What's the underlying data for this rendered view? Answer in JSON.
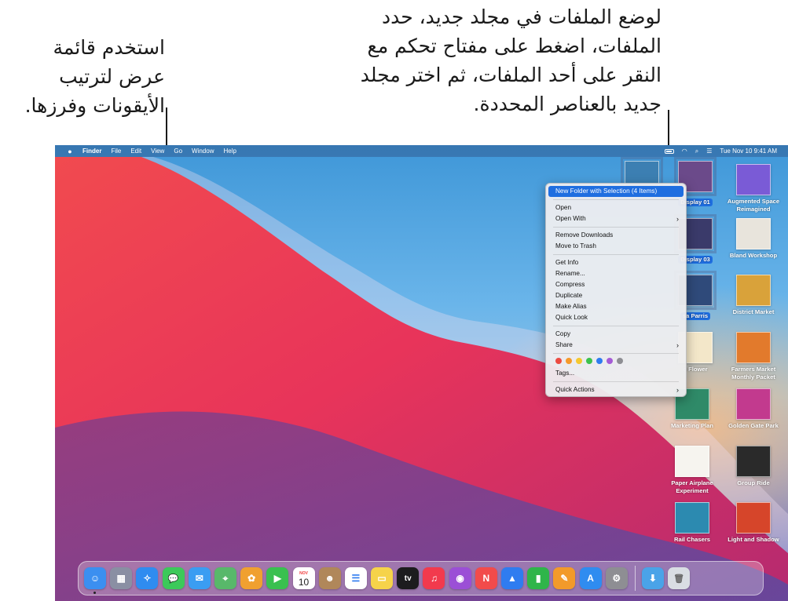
{
  "callouts": {
    "left": [
      "استخدم قائمة",
      "عرض لترتيب",
      "الأيقونات وفرزها."
    ],
    "right": [
      "لوضع الملفات في مجلد جديد، حدد",
      "الملفات، اضغط على مفتاح تحكم مع",
      "النقر على أحد الملفات، ثم اختر مجلد",
      "جديد بالعناصر المحددة."
    ]
  },
  "menubar": {
    "apple": "",
    "app_name": "Finder",
    "menus": [
      "File",
      "Edit",
      "View",
      "Go",
      "Window",
      "Help"
    ],
    "clock": "Tue Nov 10  9:41 AM"
  },
  "desktop_icons": [
    {
      "label": "Display 01",
      "selected": true,
      "color": "#6b4a8a"
    },
    {
      "label": "Augmented Space Reimagined",
      "selected": false,
      "color": "#7a5bd6"
    },
    {
      "label": "Display 03",
      "selected": true,
      "color": "#3a3a6a"
    },
    {
      "label": "Bland Workshop",
      "selected": false,
      "color": "#e8e4dc"
    },
    {
      "label": "sa Parris",
      "selected": true,
      "color": "#2f4a7a"
    },
    {
      "label": "District Market",
      "selected": false,
      "color": "#d9a23a"
    },
    {
      "label": "o Flower",
      "selected": false,
      "color": "#f3e7c9"
    },
    {
      "label": "Farmers Market Monthly Packet",
      "selected": false,
      "color": "#e27a2c"
    },
    {
      "label": "Marketing Plan",
      "selected": false,
      "color": "#2f8a68"
    },
    {
      "label": "Golden Gate Park",
      "selected": false,
      "color": "#c23a8e"
    },
    {
      "label": "Paper Airplane Experiment",
      "selected": false,
      "color": "#f6f4ef"
    },
    {
      "label": "Group Ride",
      "selected": false,
      "color": "#2a2a2a"
    },
    {
      "label": "Rail Chasers",
      "selected": false,
      "color": "#2c8ab0"
    },
    {
      "label": "Light and Shadow",
      "selected": false,
      "color": "#d6452a"
    },
    {
      "label": "",
      "selected": true,
      "color": "#3c7fb2"
    }
  ],
  "context_menu": {
    "groups": [
      [
        {
          "label": "New Folder with Selection (4 Items)",
          "highlighted": true,
          "submenu": false
        }
      ],
      [
        {
          "label": "Open",
          "submenu": false
        },
        {
          "label": "Open With",
          "submenu": true
        }
      ],
      [
        {
          "label": "Remove Downloads",
          "submenu": false
        },
        {
          "label": "Move to Trash",
          "submenu": false
        }
      ],
      [
        {
          "label": "Get Info",
          "submenu": false
        },
        {
          "label": "Rename...",
          "submenu": false
        },
        {
          "label": "Compress",
          "submenu": false
        },
        {
          "label": "Duplicate",
          "submenu": false
        },
        {
          "label": "Make Alias",
          "submenu": false
        },
        {
          "label": "Quick Look",
          "submenu": false
        }
      ],
      [
        {
          "label": "Copy",
          "submenu": false
        },
        {
          "label": "Share",
          "submenu": true
        }
      ]
    ],
    "tag_colors": [
      "#ec4b42",
      "#f59a2a",
      "#f5c82f",
      "#3cc24d",
      "#2f7cf0",
      "#a55bd6",
      "#8e8e93"
    ],
    "tags_label": "Tags...",
    "quick_actions_label": "Quick Actions",
    "chevron": "›"
  },
  "dock": {
    "apps": [
      {
        "name": "Finder",
        "glyph": "☺",
        "color": "#3b8ff0",
        "running": true
      },
      {
        "name": "Launchpad",
        "glyph": "▦",
        "color": "#8a8fa3",
        "running": false
      },
      {
        "name": "Safari",
        "glyph": "✧",
        "color": "#2f8cf0",
        "running": false
      },
      {
        "name": "Messages",
        "glyph": "💬",
        "color": "#3cc95a",
        "running": false
      },
      {
        "name": "Mail",
        "glyph": "✉",
        "color": "#3a9df2",
        "running": false
      },
      {
        "name": "Maps",
        "glyph": "⌖",
        "color": "#58b86a",
        "running": false
      },
      {
        "name": "Photos",
        "glyph": "✿",
        "color": "#f0a030",
        "running": false
      },
      {
        "name": "FaceTime",
        "glyph": "▶",
        "color": "#39c04f",
        "running": false
      },
      {
        "name": "Calendar",
        "glyph": "10",
        "color": "#ffffff",
        "running": false,
        "top": "NOV"
      },
      {
        "name": "Contacts",
        "glyph": "☻",
        "color": "#b0875a",
        "running": false
      },
      {
        "name": "Reminders",
        "glyph": "☰",
        "color": "#ffffff",
        "running": false
      },
      {
        "name": "Notes",
        "glyph": "▭",
        "color": "#f6d34a",
        "running": false
      },
      {
        "name": "TV",
        "glyph": "tv",
        "color": "#1c1c1e",
        "running": false
      },
      {
        "name": "Music",
        "glyph": "♫",
        "color": "#f23a4d",
        "running": false
      },
      {
        "name": "Podcasts",
        "glyph": "◉",
        "color": "#9b4fd6",
        "running": false
      },
      {
        "name": "News",
        "glyph": "N",
        "color": "#f24b4b",
        "running": false
      },
      {
        "name": "Keynote",
        "glyph": "▲",
        "color": "#2f7cf0",
        "running": false
      },
      {
        "name": "Numbers",
        "glyph": "▮",
        "color": "#2fb54a",
        "running": false
      },
      {
        "name": "Pages",
        "glyph": "✎",
        "color": "#f29a2a",
        "running": false
      },
      {
        "name": "App Store",
        "glyph": "A",
        "color": "#2f8cf0",
        "running": false
      },
      {
        "name": "System Preferences",
        "glyph": "⚙",
        "color": "#8e8e93",
        "running": false
      }
    ],
    "right": [
      {
        "name": "Downloads",
        "glyph": "⬇",
        "color": "#4aa3e8"
      },
      {
        "name": "Trash",
        "glyph": "🗑",
        "color": "#d9dde3"
      }
    ]
  }
}
